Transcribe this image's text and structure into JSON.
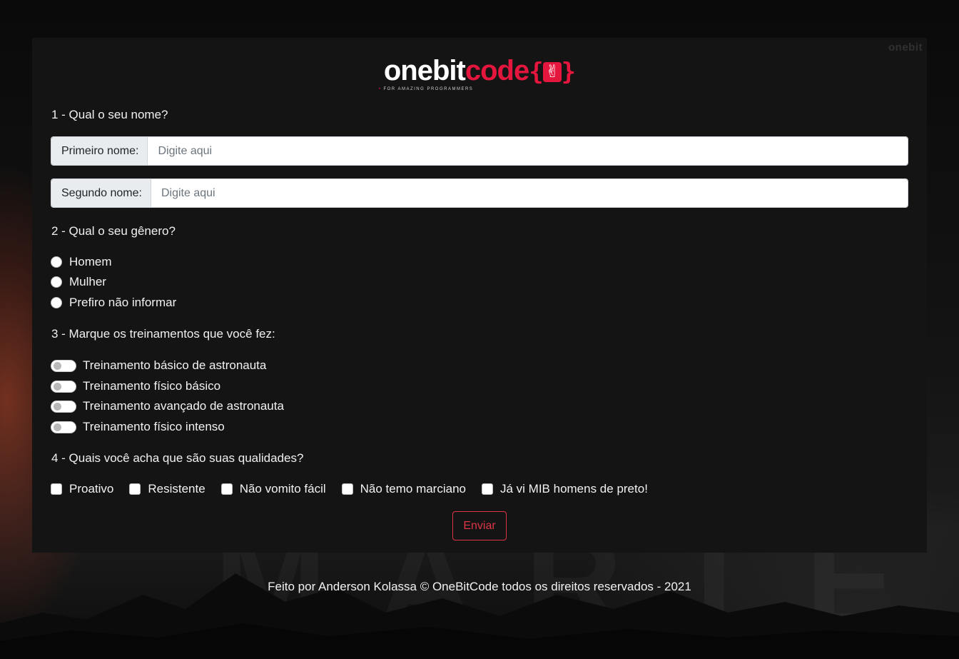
{
  "colors": {
    "accent": "#e5163e",
    "button_outline": "#dc3545",
    "card_bg": "#141414"
  },
  "logo": {
    "brand_one": "onebit",
    "brand_code": "code",
    "tagline": "FOR AMAZING PROGRAMMERS",
    "icon": "rock-hand-icon"
  },
  "corner_logo": "onebit",
  "background_text": "MARTE",
  "q1": {
    "title": "1 - Qual o seu nome?",
    "first_label": "Primeiro nome:",
    "first_placeholder": "Digite aqui",
    "first_value": "",
    "second_label": "Segundo nome:",
    "second_placeholder": "Digite aqui",
    "second_value": ""
  },
  "q2": {
    "title": "2 - Qual o seu gênero?",
    "options": [
      "Homem",
      "Mulher",
      "Prefiro não informar"
    ],
    "selected": null
  },
  "q3": {
    "title": "3 - Marque os treinamentos que você fez:",
    "options": [
      {
        "label": "Treinamento básico de astronauta",
        "checked": false
      },
      {
        "label": "Treinamento físico básico",
        "checked": false
      },
      {
        "label": "Treinamento avançado de astronauta",
        "checked": false
      },
      {
        "label": "Treinamento físico intenso",
        "checked": false
      }
    ]
  },
  "q4": {
    "title": "4 - Quais você acha que são suas qualidades?",
    "options": [
      {
        "label": "Proativo",
        "checked": false
      },
      {
        "label": "Resistente",
        "checked": false
      },
      {
        "label": "Não vomito fácil",
        "checked": false
      },
      {
        "label": "Não temo marciano",
        "checked": false
      },
      {
        "label": "Já vi MIB homens de preto!",
        "checked": false
      }
    ]
  },
  "submit_label": "Enviar",
  "footer": "Feito por Anderson Kolassa © OneBitCode todos os direitos reservados - 2021"
}
